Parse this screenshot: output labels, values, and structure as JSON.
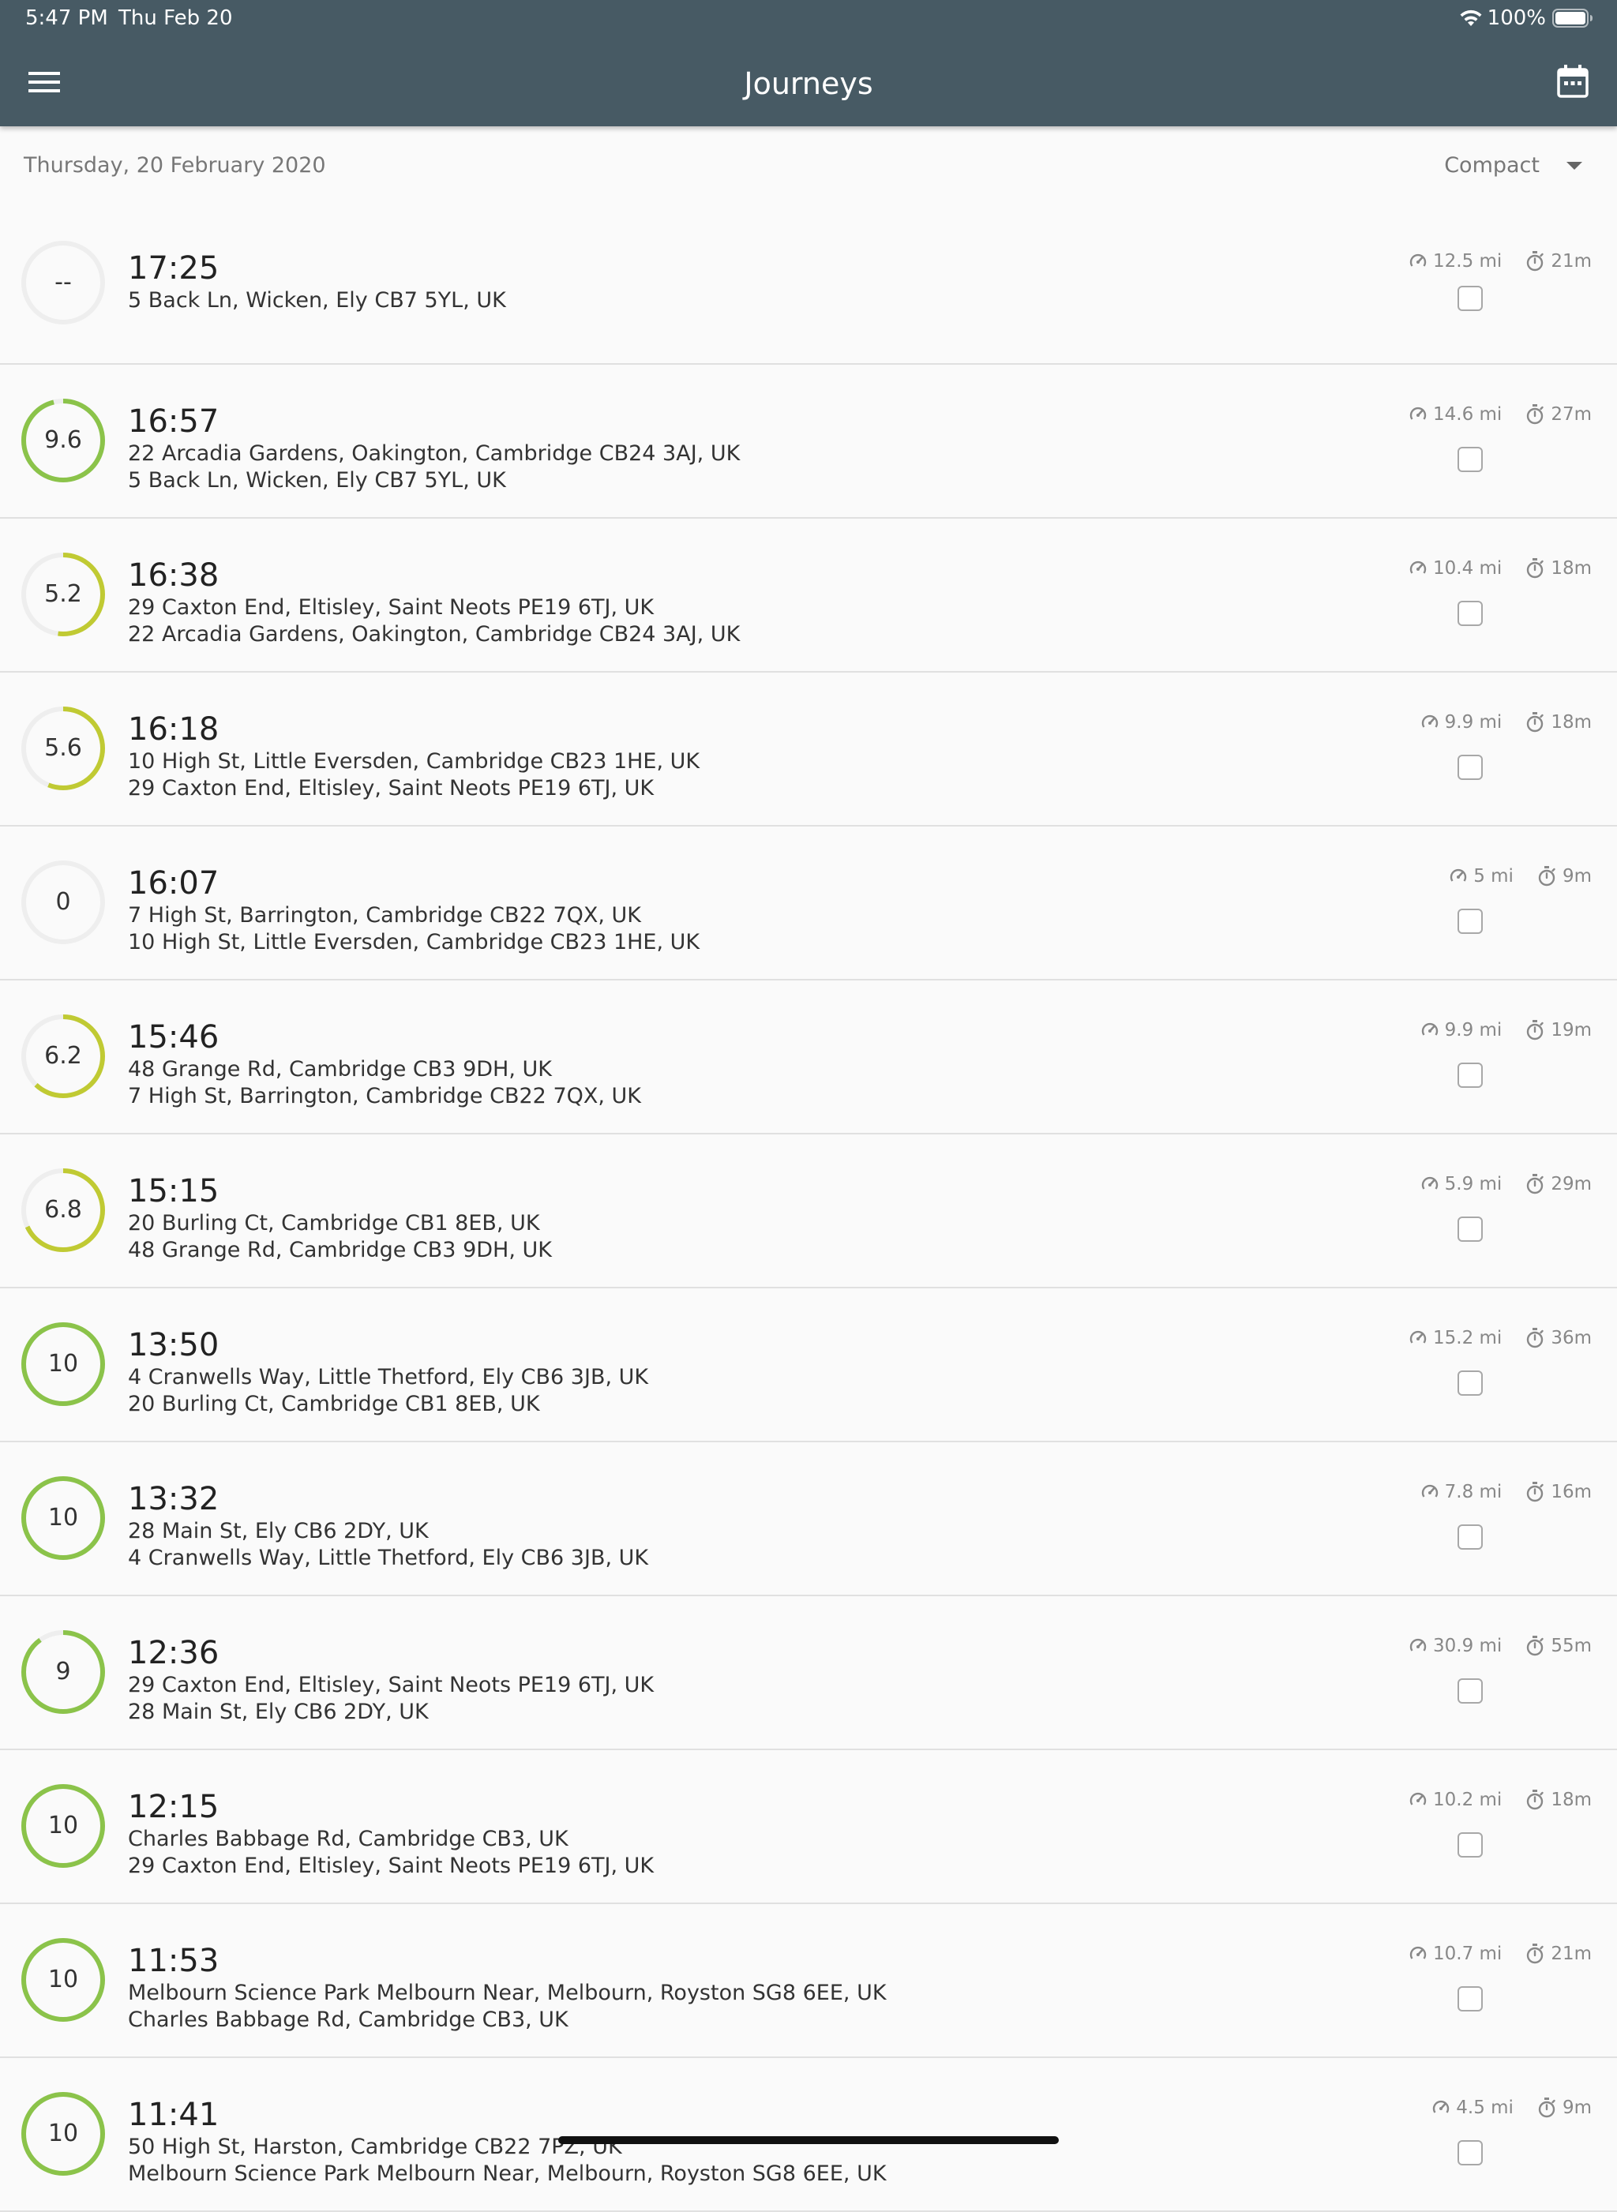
{
  "status_bar": {
    "time": "5:47 PM",
    "date": "Thu Feb 20",
    "battery": "100%"
  },
  "header": {
    "title": "Journeys"
  },
  "date_label": "Thursday, 20 February 2020",
  "view_mode": "Compact",
  "colors": {
    "header_bg": "#475a64",
    "score_high": "#8bc34a",
    "score_mid": "#c0ca33",
    "track": "#eeeeee"
  },
  "journeys": [
    {
      "time": "17:25",
      "score": "--",
      "score_value": 0,
      "color": "#8bc34a",
      "from": "5 Back Ln, Wicken, Ely CB7 5YL, UK",
      "to": "",
      "distance": "12.5 mi",
      "duration": "21m"
    },
    {
      "time": "16:57",
      "score": "9.6",
      "score_value": 9.6,
      "color": "#8bc34a",
      "from": "22 Arcadia Gardens, Oakington, Cambridge CB24 3AJ, UK",
      "to": "5 Back Ln, Wicken, Ely CB7 5YL, UK",
      "distance": "14.6 mi",
      "duration": "27m"
    },
    {
      "time": "16:38",
      "score": "5.2",
      "score_value": 5.2,
      "color": "#c0ca33",
      "from": "29 Caxton End, Eltisley, Saint Neots PE19 6TJ, UK",
      "to": "22 Arcadia Gardens, Oakington, Cambridge CB24 3AJ, UK",
      "distance": "10.4 mi",
      "duration": "18m"
    },
    {
      "time": "16:18",
      "score": "5.6",
      "score_value": 5.6,
      "color": "#c0ca33",
      "from": "10 High St, Little Eversden, Cambridge CB23 1HE, UK",
      "to": "29 Caxton End, Eltisley, Saint Neots PE19 6TJ, UK",
      "distance": "9.9 mi",
      "duration": "18m"
    },
    {
      "time": "16:07",
      "score": "0",
      "score_value": 0,
      "color": "#c0ca33",
      "from": "7 High St, Barrington, Cambridge CB22 7QX, UK",
      "to": "10 High St, Little Eversden, Cambridge CB23 1HE, UK",
      "distance": "5 mi",
      "duration": "9m"
    },
    {
      "time": "15:46",
      "score": "6.2",
      "score_value": 6.2,
      "color": "#c0ca33",
      "from": "48 Grange Rd, Cambridge CB3 9DH, UK",
      "to": "7 High St, Barrington, Cambridge CB22 7QX, UK",
      "distance": "9.9 mi",
      "duration": "19m"
    },
    {
      "time": "15:15",
      "score": "6.8",
      "score_value": 6.8,
      "color": "#c0ca33",
      "from": "20 Burling Ct, Cambridge CB1 8EB, UK",
      "to": "48 Grange Rd, Cambridge CB3 9DH, UK",
      "distance": "5.9 mi",
      "duration": "29m"
    },
    {
      "time": "13:50",
      "score": "10",
      "score_value": 10,
      "color": "#8bc34a",
      "from": "4 Cranwells Way, Little Thetford, Ely CB6 3JB, UK",
      "to": "20 Burling Ct, Cambridge CB1 8EB, UK",
      "distance": "15.2 mi",
      "duration": "36m"
    },
    {
      "time": "13:32",
      "score": "10",
      "score_value": 10,
      "color": "#8bc34a",
      "from": "28 Main St, Ely CB6 2DY, UK",
      "to": "4 Cranwells Way, Little Thetford, Ely CB6 3JB, UK",
      "distance": "7.8 mi",
      "duration": "16m"
    },
    {
      "time": "12:36",
      "score": "9",
      "score_value": 9,
      "color": "#8bc34a",
      "from": "29 Caxton End, Eltisley, Saint Neots PE19 6TJ, UK",
      "to": "28 Main St, Ely CB6 2DY, UK",
      "distance": "30.9 mi",
      "duration": "55m"
    },
    {
      "time": "12:15",
      "score": "10",
      "score_value": 10,
      "color": "#8bc34a",
      "from": "Charles Babbage Rd, Cambridge CB3, UK",
      "to": "29 Caxton End, Eltisley, Saint Neots PE19 6TJ, UK",
      "distance": "10.2 mi",
      "duration": "18m"
    },
    {
      "time": "11:53",
      "score": "10",
      "score_value": 10,
      "color": "#8bc34a",
      "from": "Melbourn Science Park Melbourn Near, Melbourn, Royston SG8 6EE, UK",
      "to": "Charles Babbage Rd, Cambridge CB3, UK",
      "distance": "10.7 mi",
      "duration": "21m"
    },
    {
      "time": "11:41",
      "score": "10",
      "score_value": 10,
      "color": "#8bc34a",
      "from": "50 High St, Harston, Cambridge CB22 7PZ, UK",
      "to": "Melbourn Science Park Melbourn Near, Melbourn, Royston SG8 6EE, UK",
      "distance": "4.5 mi",
      "duration": "9m"
    }
  ]
}
